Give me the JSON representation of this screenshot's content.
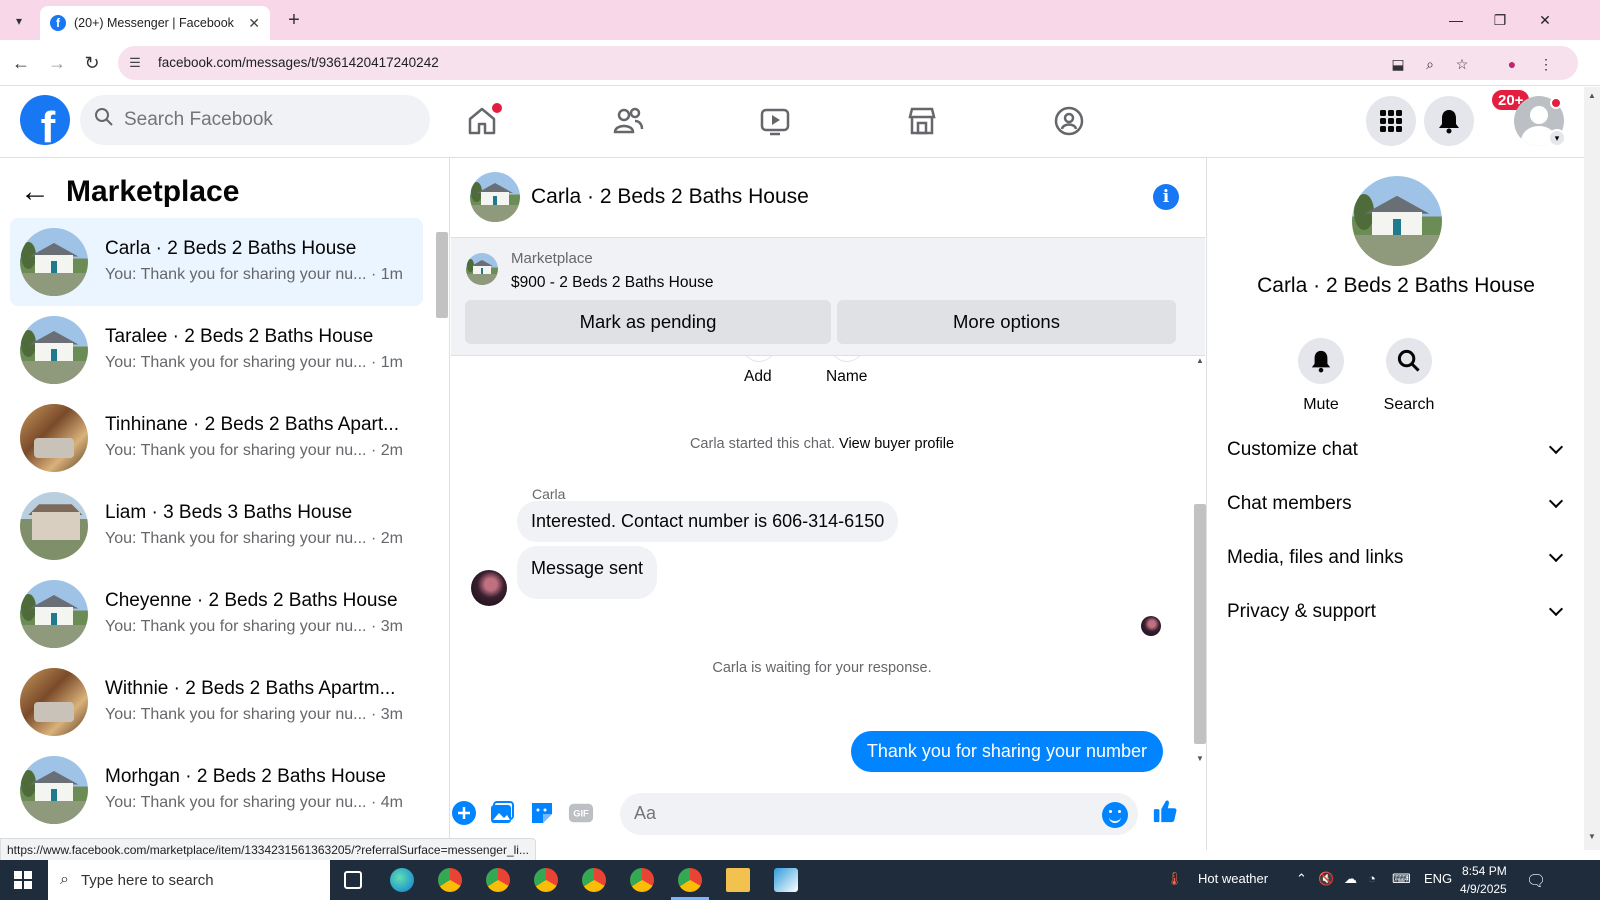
{
  "browser": {
    "tab_title": "(20+) Messenger | Facebook",
    "url": "facebook.com/messages/t/9361420417240242",
    "status_url": "https://www.facebook.com/marketplace/item/1334231561363205/?referralSurface=messenger_li..."
  },
  "header": {
    "search_placeholder": "Search Facebook",
    "notification_badge": "20+"
  },
  "sidebar": {
    "title": "Marketplace",
    "conversations": [
      {
        "name": "Carla · 2 Beds 2 Baths House",
        "preview": "You: Thank you for sharing your nu... · 1m",
        "thumb": "house",
        "active": true
      },
      {
        "name": "Taralee · 2 Beds 2 Baths House",
        "preview": "You: Thank you for sharing your nu... · 1m",
        "thumb": "house"
      },
      {
        "name": "Tinhinane · 2 Beds 2 Baths Apart...",
        "preview": "You: Thank you for sharing your nu... · 2m",
        "thumb": "room"
      },
      {
        "name": "Liam · 3 Beds 3 Baths House",
        "preview": "You: Thank you for sharing your nu... · 2m",
        "thumb": "bighouse"
      },
      {
        "name": "Cheyenne · 2 Beds 2 Baths House",
        "preview": "You: Thank you for sharing your nu... · 3m",
        "thumb": "house"
      },
      {
        "name": "Withnie · 2 Beds 2 Baths Apartm...",
        "preview": "You: Thank you for sharing your nu... · 3m",
        "thumb": "room"
      },
      {
        "name": "Morhgan · 2 Beds 2 Baths House",
        "preview": "You: Thank you for sharing your nu... · 4m",
        "thumb": "house"
      }
    ]
  },
  "chat": {
    "title": "Carla · 2 Beds 2 Baths House",
    "listing_category": "Marketplace",
    "listing_price_title": "$900 - 2 Beds 2 Baths House",
    "mark_pending_label": "Mark as pending",
    "more_options_label": "More options",
    "peek_add_label": "Add",
    "peek_name_label": "Name",
    "started_text": "Carla started this chat. ",
    "view_buyer_label": "View buyer profile",
    "sender_name": "Carla",
    "message_1": "Interested.  Contact number is 606-314-6150",
    "message_2": "Message sent",
    "waiting_text": "Carla is waiting for your response.",
    "outgoing_message": "Thank you for sharing your number",
    "composer_placeholder": "Aa"
  },
  "details": {
    "name": "Carla · 2 Beds 2 Baths House",
    "mute_label": "Mute",
    "search_label": "Search",
    "sections": [
      "Customize chat",
      "Chat members",
      "Media, files and links",
      "Privacy & support"
    ]
  },
  "taskbar": {
    "search_placeholder": "Type here to search",
    "weather": "Hot weather",
    "language": "ENG",
    "time": "8:54 PM",
    "date": "4/9/2025"
  },
  "colors": {
    "fb_blue": "#1877f2",
    "messenger_blue": "#0084ff",
    "badge_red": "#e41e3f"
  }
}
